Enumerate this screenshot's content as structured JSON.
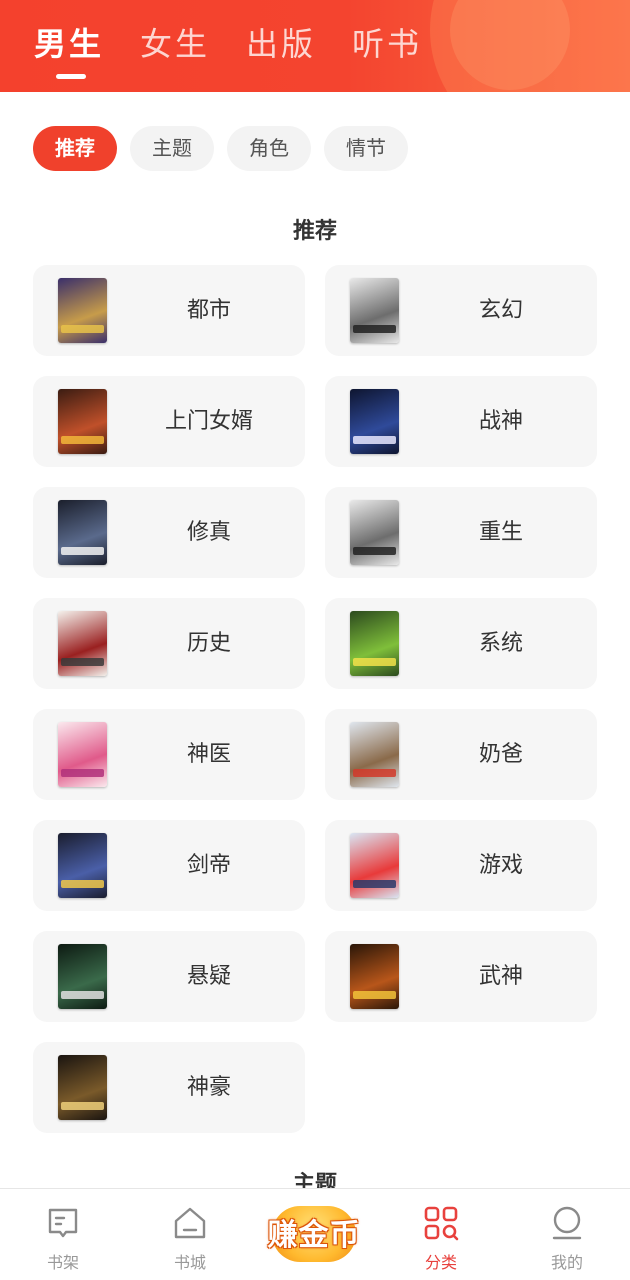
{
  "top_tabs": [
    {
      "label": "男生",
      "active": true
    },
    {
      "label": "女生",
      "active": false
    },
    {
      "label": "出版",
      "active": false
    },
    {
      "label": "听书",
      "active": false
    }
  ],
  "filter_chips": [
    {
      "label": "推荐",
      "active": true
    },
    {
      "label": "主题",
      "active": false
    },
    {
      "label": "角色",
      "active": false
    },
    {
      "label": "情节",
      "active": false
    }
  ],
  "sections": {
    "recommend_title": "推荐",
    "theme_title": "主题"
  },
  "categories": [
    {
      "label": "都市",
      "cover": [
        "#3a2f6b",
        "#c79c4a",
        "#e8c24a"
      ]
    },
    {
      "label": "玄幻",
      "cover": [
        "#e9e9e9",
        "#6d6d6d",
        "#222222"
      ]
    },
    {
      "label": "上门女婿",
      "cover": [
        "#3b1c12",
        "#c0502a",
        "#f2b63a"
      ]
    },
    {
      "label": "战神",
      "cover": [
        "#0e1530",
        "#2f4a9a",
        "#e8e8ff"
      ]
    },
    {
      "label": "修真",
      "cover": [
        "#1b1f2c",
        "#5a6a8c",
        "#f2f2f2"
      ]
    },
    {
      "label": "重生",
      "cover": [
        "#e9e9e9",
        "#6d6d6d",
        "#222222"
      ]
    },
    {
      "label": "历史",
      "cover": [
        "#f4f1ec",
        "#9a2020",
        "#3a3a3a"
      ]
    },
    {
      "label": "系统",
      "cover": [
        "#2c4a1e",
        "#7fbf3a",
        "#f2e14a"
      ]
    },
    {
      "label": "神医",
      "cover": [
        "#fbe9ee",
        "#e05a8a",
        "#b0307a"
      ]
    },
    {
      "label": "奶爸",
      "cover": [
        "#dfe6ee",
        "#8a6a4a",
        "#d23a2a"
      ]
    },
    {
      "label": "剑帝",
      "cover": [
        "#1a1d2e",
        "#4a5fa8",
        "#f0c84a"
      ]
    },
    {
      "label": "游戏",
      "cover": [
        "#d9e6f4",
        "#e83a3a",
        "#2a3a6a"
      ]
    },
    {
      "label": "悬疑",
      "cover": [
        "#0d1a12",
        "#3a6a4a",
        "#e0e0e0"
      ]
    },
    {
      "label": "武神",
      "cover": [
        "#2a1608",
        "#b8561a",
        "#f2c23a"
      ]
    },
    {
      "label": "神豪",
      "cover": [
        "#1a1410",
        "#7a5a2a",
        "#f0d07a"
      ]
    }
  ],
  "bottom_nav": {
    "bookshelf": "书架",
    "bookstore": "书城",
    "earn": "赚金币",
    "category": "分类",
    "mine": "我的"
  },
  "colors": {
    "accent": "#f0412c",
    "nav_active": "#e8413d",
    "card_bg": "#f6f6f6"
  }
}
